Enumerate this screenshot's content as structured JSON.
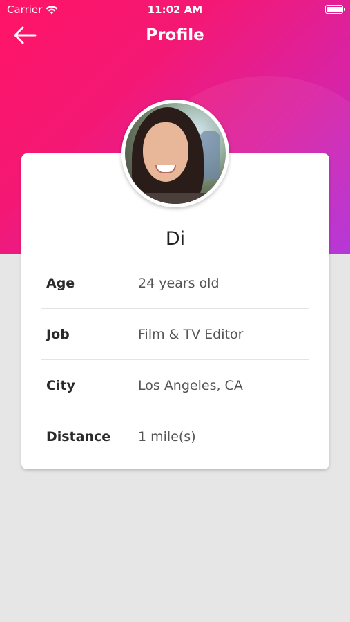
{
  "status_bar": {
    "carrier": "Carrier",
    "time": "11:02 AM",
    "icons": [
      "wifi-icon",
      "battery-icon"
    ]
  },
  "nav": {
    "title": "Profile",
    "back_icon": "arrow-left-icon"
  },
  "profile": {
    "name": "Di",
    "avatar": "profile-photo",
    "fields": [
      {
        "label": "Age",
        "value": "24 years old"
      },
      {
        "label": "Job",
        "value": "Film & TV Editor"
      },
      {
        "label": "City",
        "value": "Los Angeles, CA"
      },
      {
        "label": "Distance",
        "value": "1 mile(s)"
      }
    ]
  },
  "colors": {
    "header_start": "#ff1466",
    "header_end": "#b02cd6",
    "background": "#e6e6e6",
    "card": "#ffffff"
  }
}
